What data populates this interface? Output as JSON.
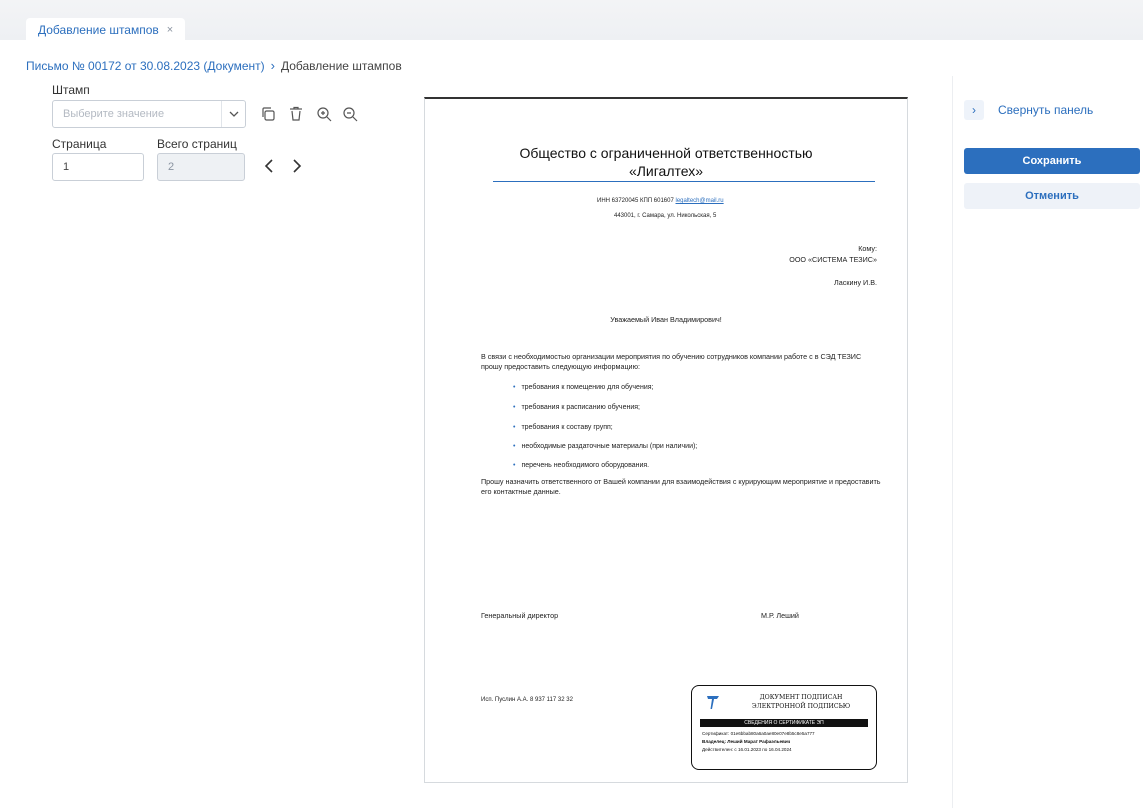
{
  "tab": {
    "label": "Добавление штампов",
    "close": "×"
  },
  "breadcrumb": {
    "parent": "Письмо № 00172 от 30.08.2023 (Документ)",
    "separator": "›",
    "current": "Добавление штампов"
  },
  "stamp_field": {
    "label": "Штамп",
    "placeholder": "Выберите значение"
  },
  "page_field": {
    "label": "Страница",
    "value": "1"
  },
  "total_field": {
    "label": "Всего страниц",
    "value": "2"
  },
  "icons": {
    "copy": "copy-icon",
    "delete": "trash-icon",
    "zoom_in": "zoom-in-icon",
    "zoom_out": "zoom-out-icon",
    "prev": "chevron-left-icon",
    "next": "chevron-right-icon"
  },
  "document": {
    "title_line1": "Общество с ограниченной ответственностью",
    "title_line2": "«Лигалтех»",
    "requisites": "ИНН 63720045 КПП 601607",
    "email": "legaltech@mail.ru",
    "address": "443001, г. Самара, ул. Никольская, 5",
    "to_label": "Кому:",
    "to_org": "ООО «СИСТЕМА ТЕЗИС»",
    "to_person": "Ласкину И.В.",
    "greeting": "Уважаемый Иван Владимирович!",
    "intro": "В связи с необходимостью организации мероприятия по обучению сотрудников компании работе с в СЭД ТЕЗИС прошу предоставить следующую информацию:",
    "items": [
      "требования к помещению для обучения;",
      "требования к расписанию обучения;",
      "требования к составу групп;",
      "необходимые раздаточные материалы (при наличии);",
      "перечень необходимого оборудования."
    ],
    "request": "Прошу назначить ответственного от Вашей компании для взаимодействия с курирующим мероприятие и предоставить его контактные данные.",
    "position": "Генеральный директор",
    "signer": "М.Р. Леший",
    "executor": "Исп. Пуслин А.А. 8 937 117 32 32"
  },
  "stamp": {
    "title_line1": "ДОКУМЕНТ ПОДПИСАН",
    "title_line2": "ЭЛЕКТРОННОЙ ПОДПИСЬЮ",
    "bar": "СВЕДЕНИЯ О СЕРТИФИКАТЕ ЭП",
    "certificate": "Сертификат: 01e6bbab80a6a0ae80e07e8b5c8e5a777",
    "owner": "Владелец: Леший Марат Рафаэльевич",
    "validity": "Действителен: с 16.01.2023 по 16.04.2024"
  },
  "side": {
    "collapse_label": "Свернуть панель",
    "save_label": "Сохранить",
    "cancel_label": "Отменить"
  },
  "colors": {
    "accent": "#2c6fbe",
    "button_secondary_bg": "#eef2f8"
  }
}
